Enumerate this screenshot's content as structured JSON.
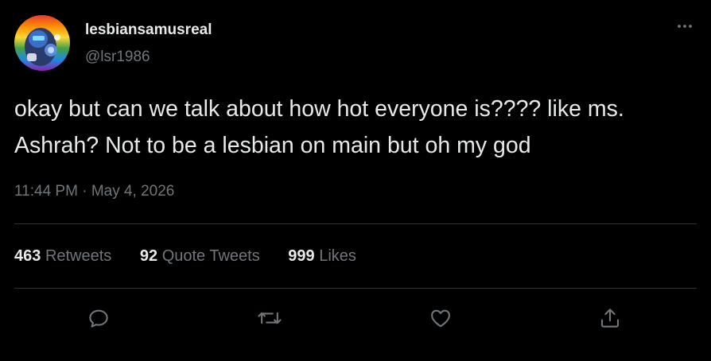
{
  "user": {
    "display_name": "lesbiansamusreal",
    "handle": "@lsr1986"
  },
  "tweet": {
    "text": "okay but can we talk about how hot everyone is???? like ms. Ashrah? Not to be a lesbian on main but oh my god",
    "time": "11:44 PM",
    "separator": "·",
    "date": "May 4, 2026"
  },
  "stats": {
    "retweets_count": "463",
    "retweets_label": "Retweets",
    "quotes_count": "92",
    "quotes_label": "Quote Tweets",
    "likes_count": "999",
    "likes_label": "Likes"
  },
  "icons": {
    "more": "more-dots-icon",
    "reply": "reply-icon",
    "retweet": "retweet-icon",
    "like": "heart-icon",
    "share": "share-icon"
  },
  "colors": {
    "background": "#000000",
    "text_primary": "#e7e9ea",
    "text_secondary": "#71767b",
    "divider": "#2f3336"
  }
}
